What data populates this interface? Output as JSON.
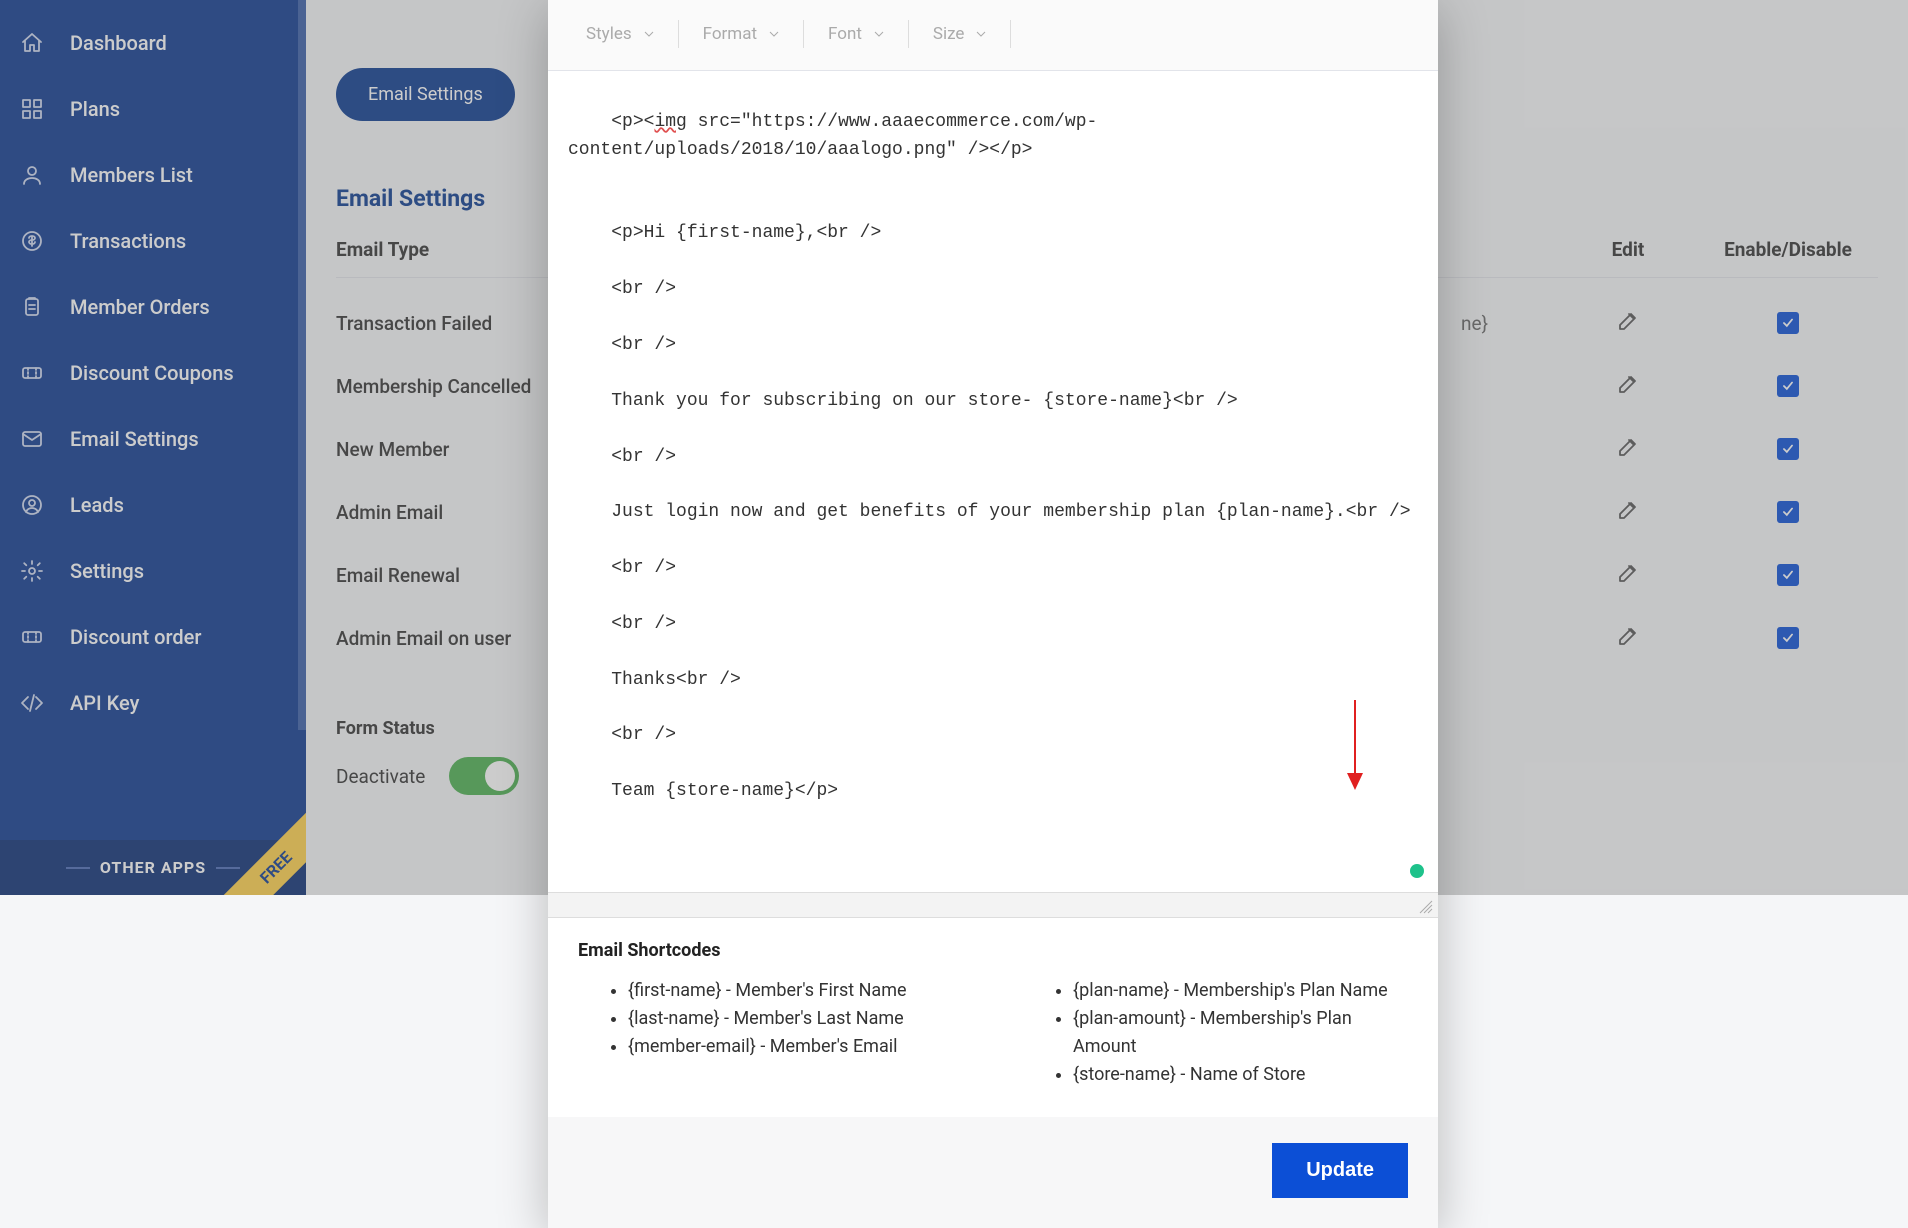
{
  "sidebar": {
    "items": [
      {
        "label": "Dashboard",
        "icon": "home-icon"
      },
      {
        "label": "Plans",
        "icon": "grid-icon"
      },
      {
        "label": "Members List",
        "icon": "user-icon"
      },
      {
        "label": "Transactions",
        "icon": "dollar-circle-icon"
      },
      {
        "label": "Member Orders",
        "icon": "clipboard-icon"
      },
      {
        "label": "Discount Coupons",
        "icon": "ticket-icon"
      },
      {
        "label": "Email Settings",
        "icon": "mail-icon"
      },
      {
        "label": "Leads",
        "icon": "target-user-icon"
      },
      {
        "label": "Settings",
        "icon": "gear-icon"
      },
      {
        "label": "Discount order",
        "icon": "ticket-icon"
      },
      {
        "label": "API Key",
        "icon": "code-icon"
      }
    ],
    "other_apps_label": "OTHER APPS",
    "free_badge": "FREE"
  },
  "main": {
    "pill_button": "Email Settings",
    "section_title": "Email Settings",
    "table": {
      "headers": {
        "type": "Email Type",
        "edit": "Edit",
        "enable": "Enable/Disable"
      },
      "rows": [
        {
          "type": "Transaction Failed",
          "extra_text_visible": "ne}"
        },
        {
          "type": "Membership Cancelled"
        },
        {
          "type": "New Member"
        },
        {
          "type": "Admin Email"
        },
        {
          "type": "Email Renewal"
        },
        {
          "type": "Admin Email on user"
        }
      ]
    },
    "form_status_heading": "Form Status",
    "deactivate_label": "Deactivate"
  },
  "modal": {
    "toolbar": {
      "styles": "Styles",
      "format": "Format",
      "font": "Font",
      "size": "Size"
    },
    "editor_content": "<p><img src=\"https://www.aaaecommerce.com/wp-content/uploads/2018/10/aaalogo.png\" /></p>\n\n<p>Hi {first-name},<br />\n<br />\n<br />\nThank you for subscribing on our store- {store-name}<br />\n<br />\nJust login now and get benefits of your membership plan {plan-name}.<br />\n<br />\n<br />\nThanks<br />\n<br />\nTeam {store-name}</p>",
    "shortcodes_heading": "Email Shortcodes",
    "shortcodes_left": [
      "{first-name} - Member's First Name",
      "{last-name} - Member's Last Name",
      "{member-email} - Member's Email"
    ],
    "shortcodes_right": [
      "{plan-name} - Membership's Plan Name",
      "{plan-amount} - Membership's Plan Amount",
      "{store-name} - Name of Store"
    ],
    "update_label": "Update"
  }
}
